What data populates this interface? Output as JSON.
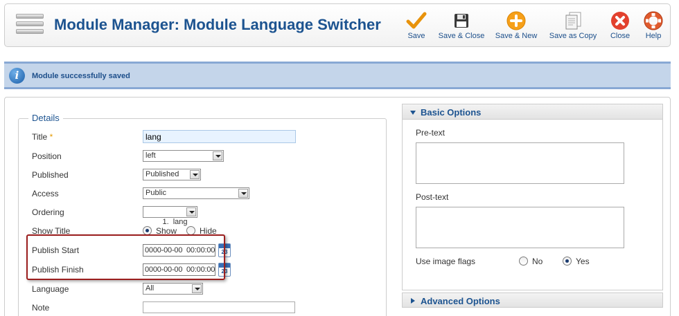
{
  "toolbar": {
    "title": "Module Manager: Module Language Switcher",
    "buttons": {
      "save": "Save",
      "save_close": "Save & Close",
      "save_new": "Save & New",
      "save_copy": "Save as Copy",
      "close": "Close",
      "help": "Help"
    }
  },
  "message": {
    "icon_glyph": "i",
    "text": "Module successfully saved"
  },
  "details": {
    "legend": "Details",
    "title_label": "Title",
    "required_mark": "*",
    "title_value": "lang",
    "position_label": "Position",
    "position_value": "left",
    "published_label": "Published",
    "published_value": "Published",
    "access_label": "Access",
    "access_value": "Public",
    "ordering_label": "Ordering",
    "ordering_value": "1.  lang",
    "show_title_label": "Show Title",
    "show_option": "Show",
    "hide_option": "Hide",
    "publish_start_label": "Publish Start",
    "publish_start_value": "0000-00-00  00:00:00",
    "publish_finish_label": "Publish Finish",
    "publish_finish_value": "0000-00-00  00:00:00",
    "calendar_day": "23",
    "language_label": "Language",
    "language_value": "All",
    "note_label": "Note",
    "note_value": ""
  },
  "basic_options": {
    "header": "Basic Options",
    "pre_text_label": "Pre-text",
    "post_text_label": "Post-text",
    "image_flags_label": "Use image flags",
    "no_option": "No",
    "yes_option": "Yes"
  },
  "advanced_options": {
    "header": "Advanced Options"
  },
  "colors": {
    "title_blue": "#1c5390",
    "message_bg": "#c4d5ea",
    "highlight_red": "#9b1d1d"
  },
  "icons": [
    "menu-icon",
    "checkmark-icon",
    "floppy-disk-icon",
    "plus-circle-icon",
    "copy-document-icon",
    "close-x-icon",
    "lifebuoy-icon",
    "info-icon",
    "calendar-icon"
  ]
}
